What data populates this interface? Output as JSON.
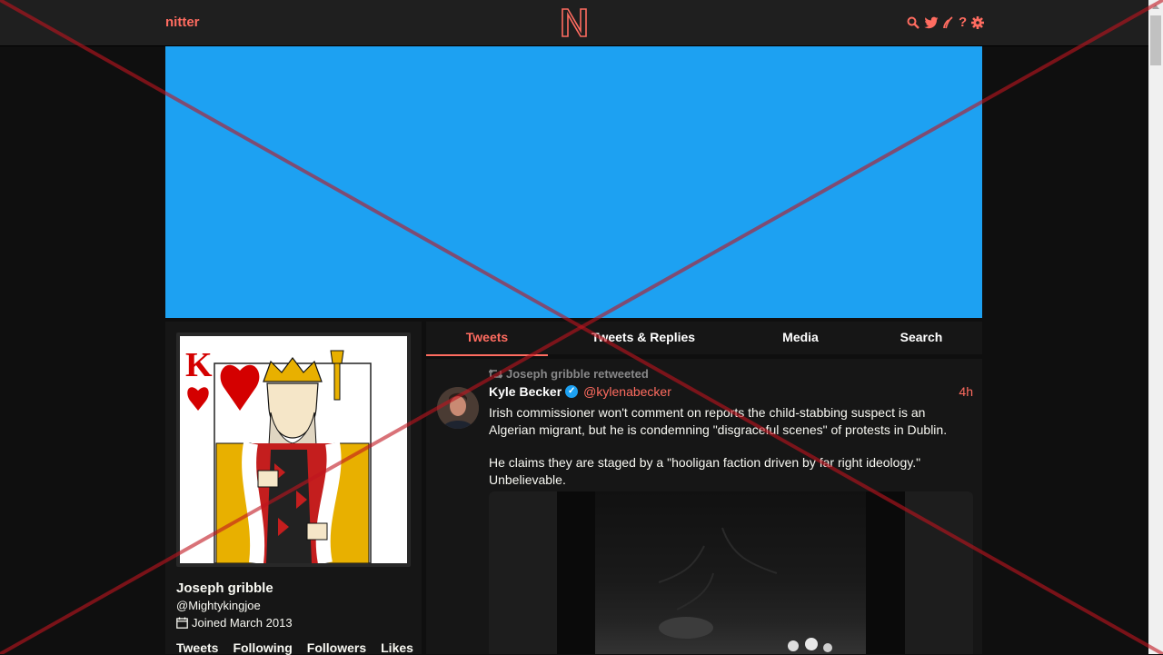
{
  "navbar": {
    "brand": "nitter",
    "logo_letter": "N",
    "icons": [
      "search-icon",
      "twitter-bird-icon",
      "rss-icon",
      "help-icon",
      "settings-gear-icon"
    ]
  },
  "colors": {
    "accent": "#ff6c60",
    "banner": "#1da1f2",
    "background": "#0f0f0f",
    "panel": "#161616",
    "navbar": "#1f1f1f"
  },
  "profile": {
    "name": "Joseph gribble",
    "handle": "@Mightykingjoe",
    "joined": "Joined March 2013",
    "stats": [
      "Tweets",
      "Following",
      "Followers",
      "Likes"
    ],
    "avatar_card_rank": "K"
  },
  "tabs": [
    {
      "label": "Tweets",
      "active": true
    },
    {
      "label": "Tweets & Replies",
      "active": false
    },
    {
      "label": "Media",
      "active": false
    },
    {
      "label": "Search",
      "active": false
    }
  ],
  "tweet": {
    "retweet_header": "Joseph gribble retweeted",
    "author_name": "Kyle Becker",
    "author_handle": "@kylenabecker",
    "time": "4h",
    "paragraphs": [
      "Irish commissioner won't comment on reports the child-stabbing suspect is an Algerian migrant, but he is condemning \"disgraceful scenes\" of protests in Dublin.",
      "He claims they are staged by a \"hooligan faction driven by far right ideology.\" Unbelievable."
    ]
  }
}
